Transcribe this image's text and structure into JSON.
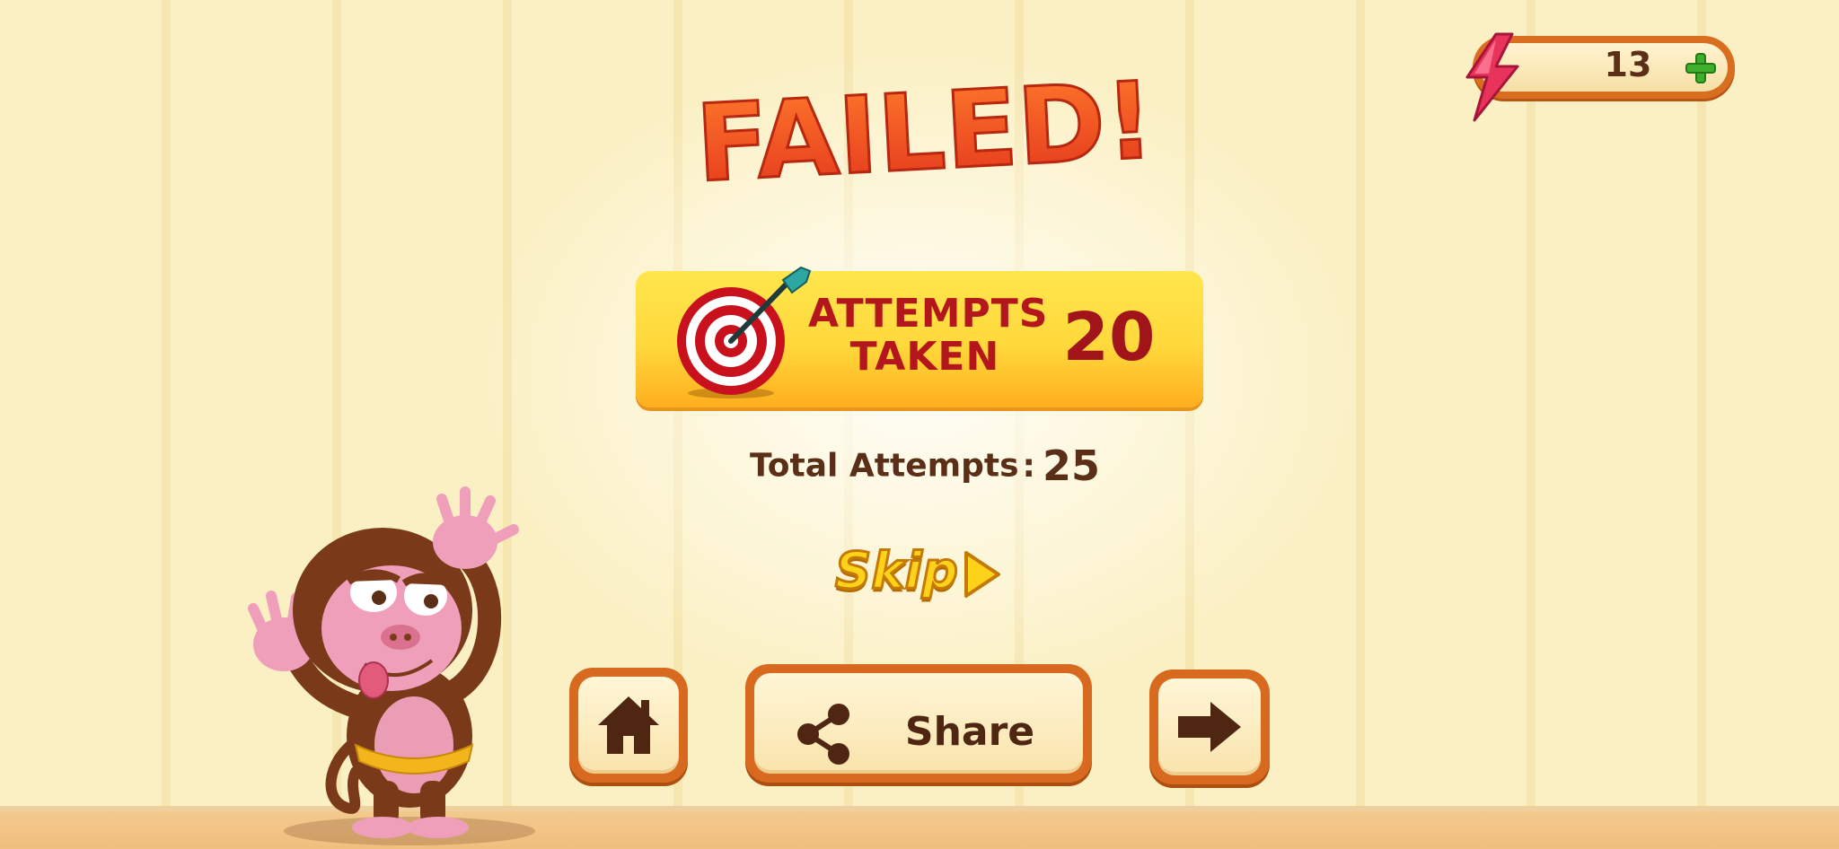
{
  "title": "FAILED!",
  "energy": {
    "count": "13",
    "icon": "lightning-bolt-icon",
    "add_icon": "plus-icon"
  },
  "attempts_taken": {
    "label_line1": "ATTEMPTS",
    "label_line2": "TAKEN",
    "value": "20",
    "icon": "target-dart-icon"
  },
  "total_attempts": {
    "label": "Total Attempts",
    "separator": ":",
    "value": "25"
  },
  "skip": {
    "label": "Skip",
    "icon": "play-arrow-icon"
  },
  "buttons": {
    "home_icon": "home-icon",
    "share_label": "Share",
    "share_icon": "share-icon",
    "next_icon": "arrow-right-icon"
  },
  "colors": {
    "title_orange": "#f0521f",
    "banner_yellow": "#ffd83b",
    "button_border": "#d86a1f",
    "text_brown": "#5a2e17",
    "attempts_red": "#b3161b"
  }
}
